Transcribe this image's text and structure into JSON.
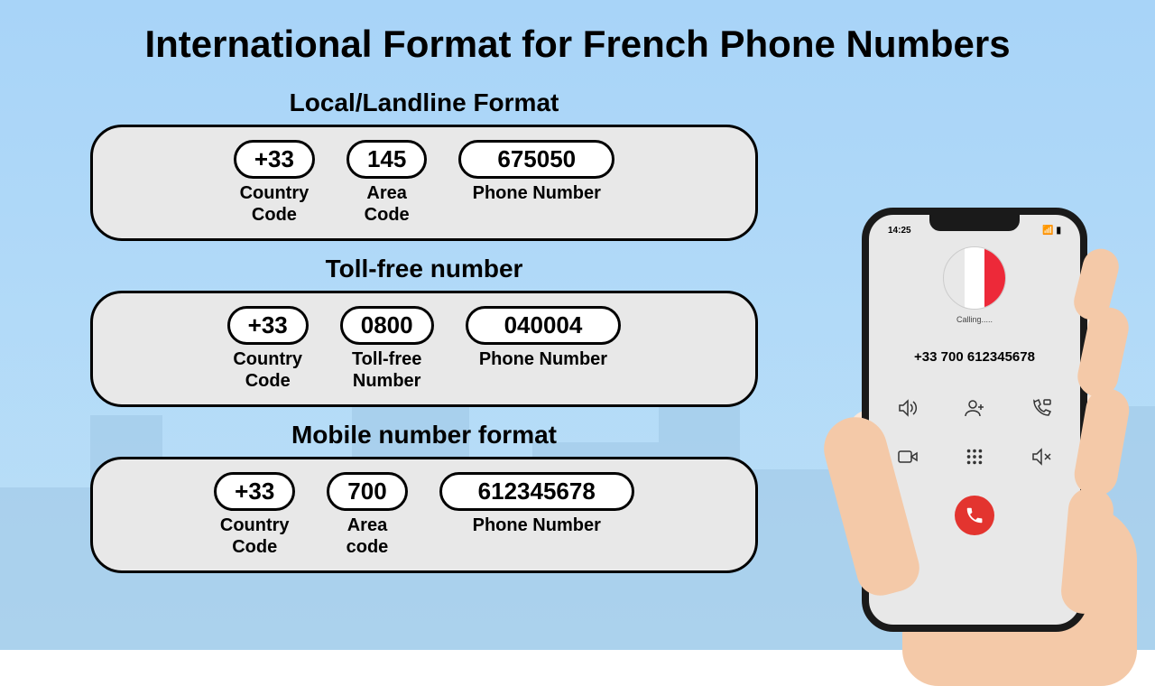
{
  "title": "International Format for French Phone Numbers",
  "sections": [
    {
      "header": "Local/Landline Format",
      "parts": [
        {
          "value": "+33",
          "label": "Country Code"
        },
        {
          "value": "145",
          "label": "Area Code"
        },
        {
          "value": "675050",
          "label": "Phone Number"
        }
      ]
    },
    {
      "header": "Toll-free number",
      "parts": [
        {
          "value": "+33",
          "label": "Country Code"
        },
        {
          "value": "0800",
          "label": "Toll-free Number"
        },
        {
          "value": "040004",
          "label": "Phone Number"
        }
      ]
    },
    {
      "header": "Mobile number format",
      "parts": [
        {
          "value": "+33",
          "label": "Country Code"
        },
        {
          "value": "700",
          "label": "Area code"
        },
        {
          "value": "612345678",
          "label": "Phone Number"
        }
      ]
    }
  ],
  "phone": {
    "time": "14:25",
    "status_text": "Calling.....",
    "number": "+33 700 612345678",
    "flag": {
      "left": "#002395",
      "middle": "#ffffff",
      "right": "#ed2939"
    }
  }
}
